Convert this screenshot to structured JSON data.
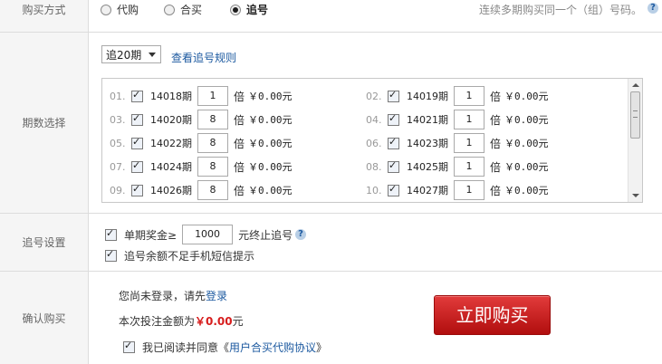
{
  "method": {
    "label": "购买方式",
    "options": [
      {
        "label": "代购",
        "selected": false
      },
      {
        "label": "合买",
        "selected": false
      },
      {
        "label": "追号",
        "selected": true
      }
    ],
    "hint": "连续多期购买同一个（组）号码。",
    "help_icon": "?"
  },
  "periods": {
    "label": "期数选择",
    "count_select": "追20期",
    "rules_link": "查看追号规则",
    "multiplier_unit": "倍",
    "items": [
      {
        "idx": "01.",
        "name": "14018期",
        "multiplier": "1",
        "amount": "￥0.00元"
      },
      {
        "idx": "02.",
        "name": "14019期",
        "multiplier": "1",
        "amount": "￥0.00元"
      },
      {
        "idx": "03.",
        "name": "14020期",
        "multiplier": "8",
        "amount": "￥0.00元"
      },
      {
        "idx": "04.",
        "name": "14021期",
        "multiplier": "1",
        "amount": "￥0.00元"
      },
      {
        "idx": "05.",
        "name": "14022期",
        "multiplier": "8",
        "amount": "￥0.00元"
      },
      {
        "idx": "06.",
        "name": "14023期",
        "multiplier": "1",
        "amount": "￥0.00元"
      },
      {
        "idx": "07.",
        "name": "14024期",
        "multiplier": "8",
        "amount": "￥0.00元"
      },
      {
        "idx": "08.",
        "name": "14025期",
        "multiplier": "1",
        "amount": "￥0.00元"
      },
      {
        "idx": "09.",
        "name": "14026期",
        "multiplier": "8",
        "amount": "￥0.00元"
      },
      {
        "idx": "10.",
        "name": "14027期",
        "multiplier": "1",
        "amount": "￥0.00元"
      }
    ]
  },
  "chase": {
    "label": "追号设置",
    "stop_prefix": "单期奖金≥",
    "stop_value": "1000",
    "stop_suffix": "元终止追号",
    "help_icon": "?",
    "sms_label": "追号余额不足手机短信提示"
  },
  "confirm": {
    "label": "确认购买",
    "login_prefix": "您尚未登录，请先",
    "login_link": "登录",
    "total_prefix": "本次投注金额为",
    "total_amount": "￥0.00",
    "total_suffix": "元",
    "buy_button": "立即购买",
    "agree_prefix": "我已阅读并同意《",
    "agree_link": "用户合买代购协议",
    "agree_suffix": "》"
  }
}
